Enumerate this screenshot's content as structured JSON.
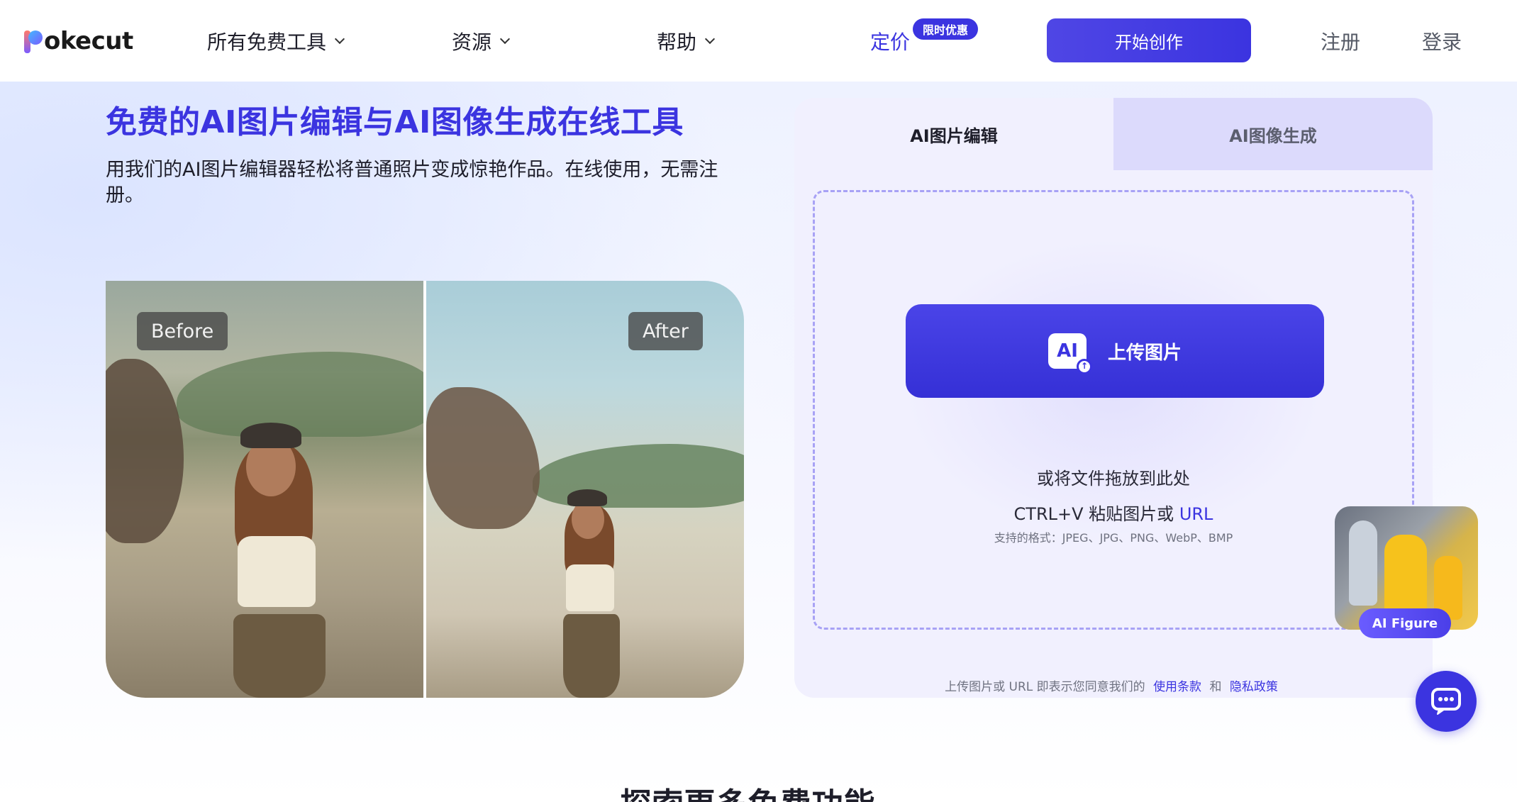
{
  "header": {
    "logo_text": "okecut",
    "nav": {
      "tools": "所有免费工具",
      "resources": "资源",
      "help": "帮助",
      "pricing": "定价",
      "promo_badge": "限时优惠"
    },
    "start_button": "开始创作",
    "signup": "注册",
    "login": "登录"
  },
  "hero": {
    "title": "免费的AI图片编辑与AI图像生成在线工具",
    "subtitle": "用我们的AI图片编辑器轻松将普通照片变成惊艳作品。在线使用，无需注册。",
    "before_label": "Before",
    "after_label": "After"
  },
  "panel": {
    "tabs": [
      {
        "label": "AI图片编辑",
        "active": true
      },
      {
        "label": "AI图像生成",
        "active": false
      }
    ],
    "upload_icon_text": "AI",
    "upload_button": "上传图片",
    "drop_text": "或将文件拖放到此处",
    "paste_text": "CTRL+V 粘贴图片或",
    "url_link": "URL",
    "formats": "支持的格式：JPEG、JPG、PNG、WebP、BMP",
    "terms_prefix": "上传图片或 URL 即表示您同意我们的",
    "terms_link": "使用条款",
    "terms_and": "和",
    "privacy_link": "隐私政策"
  },
  "widgets": {
    "ai_figure_label": "AI Figure"
  },
  "explore": {
    "title": "探索更多免费功能"
  },
  "colors": {
    "accent": "#3b34e0",
    "panel_bg": "#f1f0fe",
    "tab_inactive": "#dcdafc"
  },
  "icons": {
    "nav_chevron": "chevron-down-icon",
    "upload": "ai-upload-icon",
    "chat": "chat-bubble-icon"
  }
}
